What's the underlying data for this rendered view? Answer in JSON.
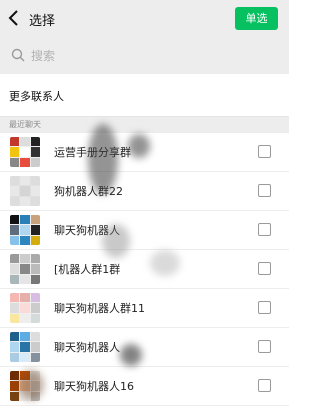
{
  "header": {
    "back_icon": "chevron-left-icon",
    "title": "选择",
    "single_select_label": "单选",
    "accent": "#07c160"
  },
  "search": {
    "icon": "search-icon",
    "placeholder": "搜索"
  },
  "more_contacts_label": "更多联系人",
  "section_label": "最近聊天",
  "rows": [
    {
      "name": "运营手册分享群"
    },
    {
      "name": "狗机器人群22"
    },
    {
      "name": "聊天狗机器人"
    },
    {
      "name": "[机器人群1群"
    },
    {
      "name": "聊天狗机器人群11"
    },
    {
      "name": "聊天狗机器人"
    },
    {
      "name": "聊天狗机器人16"
    }
  ]
}
